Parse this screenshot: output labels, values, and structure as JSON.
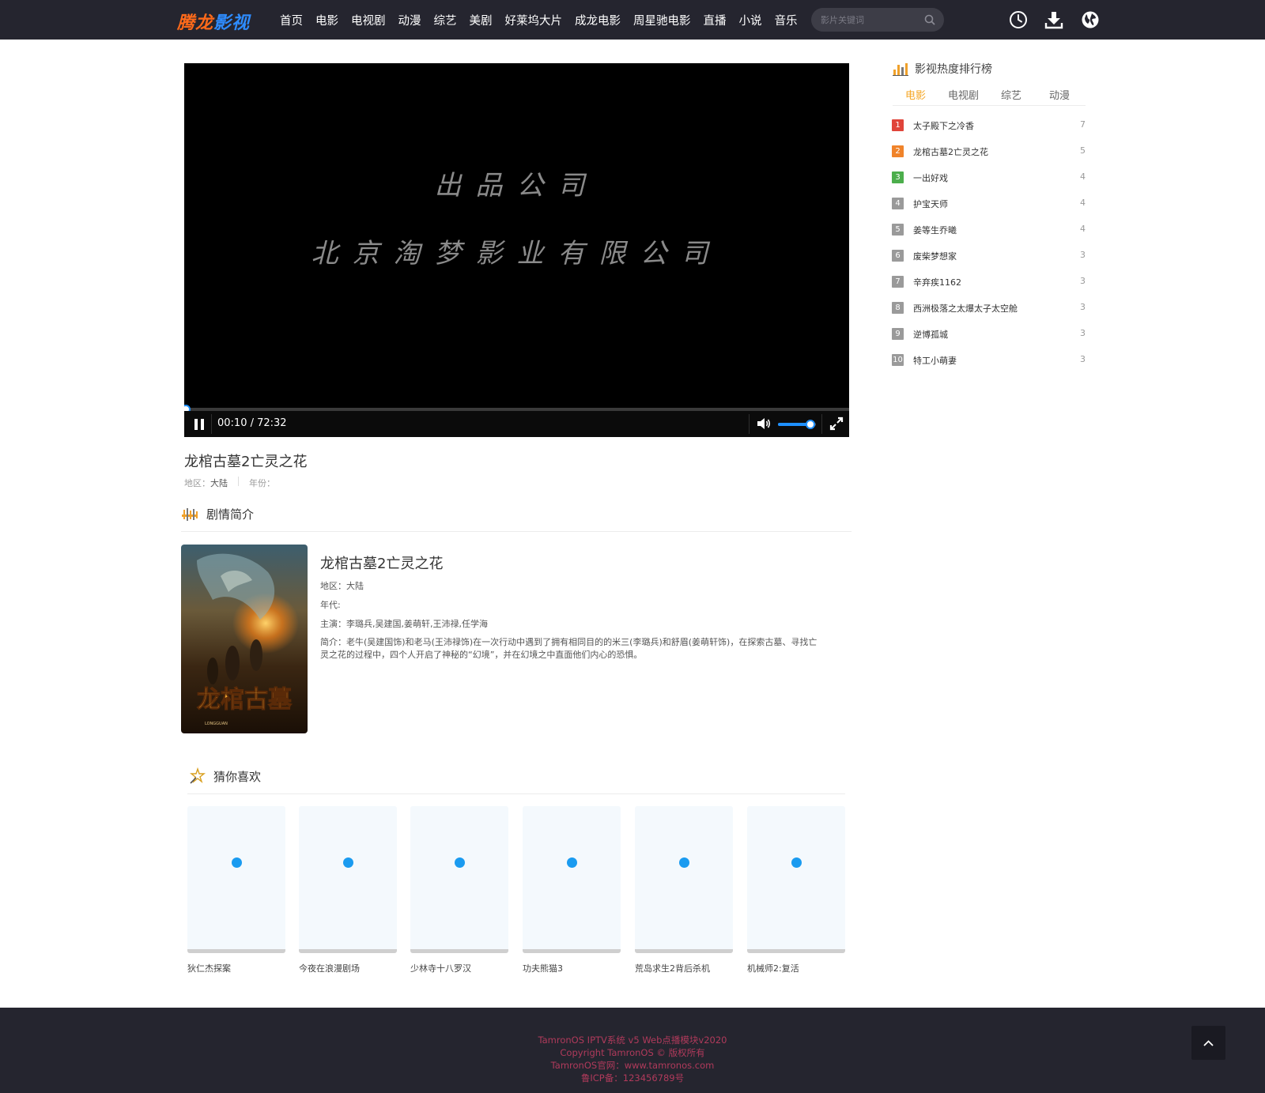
{
  "header": {
    "logo_part1": "腾龙",
    "logo_part2": "影视",
    "nav": [
      "首页",
      "电影",
      "电视剧",
      "动漫",
      "综艺",
      "美剧",
      "好莱坞大片",
      "成龙电影",
      "周星驰电影",
      "直播",
      "小说",
      "音乐"
    ],
    "search_placeholder": "影片关键词",
    "icons": [
      "clock-icon",
      "download-icon",
      "globe-icon"
    ]
  },
  "player": {
    "screen_line1": "出品公司",
    "screen_line2": "北京淘梦影业有限公司",
    "timecode": "00:10 / 72:32",
    "progress_fraction": 0.0023,
    "volume_fraction": 0.85,
    "accent_color": "#1e90ff"
  },
  "video": {
    "title": "龙棺古墓2亡灵之花",
    "region_label": "地区：",
    "region_value": "大陆",
    "year_label": "年份：",
    "year_value": ""
  },
  "plot": {
    "heading": "剧情简介",
    "title": "龙棺古墓2亡灵之花",
    "region": "地区：大陆",
    "era": "年代:",
    "cast": "主演：李璐兵,吴建国,姜萌轩,王沛禄,任学海",
    "summary_line1": "简介：老牛(吴建国饰)和老马(王沛禄饰)在一次行动中遇到了拥有相同目的的米三(李璐兵)和舒眉(姜萌轩饰)，在探索古墓、寻找亡",
    "summary_line2": "灵之花的过程中，四个人开启了神秘的“幻境”，并在幻境之中直面他们内心的恐惧。",
    "poster_title": "龙棺古墓",
    "poster_subtitle": "LONGGUAN"
  },
  "recommend": {
    "heading": "猜你喜欢",
    "items": [
      "狄仁杰探案",
      "今夜在浪漫剧场",
      "少林寺十八罗汉",
      "功夫熊猫3",
      "荒岛求生2背后杀机",
      "机械师2:复活"
    ]
  },
  "ranking": {
    "heading": "影视热度排行榜",
    "tabs": [
      "电影",
      "电视剧",
      "综艺",
      "动漫"
    ],
    "active_tab": "电影",
    "items": [
      {
        "rank": "1",
        "name": "太子殿下之冷香",
        "count": "7",
        "color": "#e0443a"
      },
      {
        "rank": "2",
        "name": "龙棺古墓2亡灵之花",
        "count": "5",
        "color": "#f0832a"
      },
      {
        "rank": "3",
        "name": "一出好戏",
        "count": "4",
        "color": "#4cae4c"
      },
      {
        "rank": "4",
        "name": "护宝天师",
        "count": "4",
        "color": "#9a9a9a"
      },
      {
        "rank": "5",
        "name": "姜等生乔曦",
        "count": "4",
        "color": "#9a9a9a"
      },
      {
        "rank": "6",
        "name": "废柴梦想家",
        "count": "3",
        "color": "#9a9a9a"
      },
      {
        "rank": "7",
        "name": "辛弃疾1162",
        "count": "3",
        "color": "#9a9a9a"
      },
      {
        "rank": "8",
        "name": "西洲极落之太爆太子太空舱",
        "count": "3",
        "color": "#9a9a9a"
      },
      {
        "rank": "9",
        "name": "逆博孤城",
        "count": "3",
        "color": "#9a9a9a"
      },
      {
        "rank": "10",
        "name": "特工小萌妻",
        "count": "3",
        "color": "#9a9a9a"
      }
    ]
  },
  "footer": {
    "line1": "TamronOS IPTV系统 v5 Web点播模块v2020",
    "line2": "Copyright TamronOS © 版权所有",
    "line3": "TamronOS官网：www.tamronos.com",
    "line4": "鲁ICP备：123456789号",
    "text_color": "#b03a5b"
  }
}
